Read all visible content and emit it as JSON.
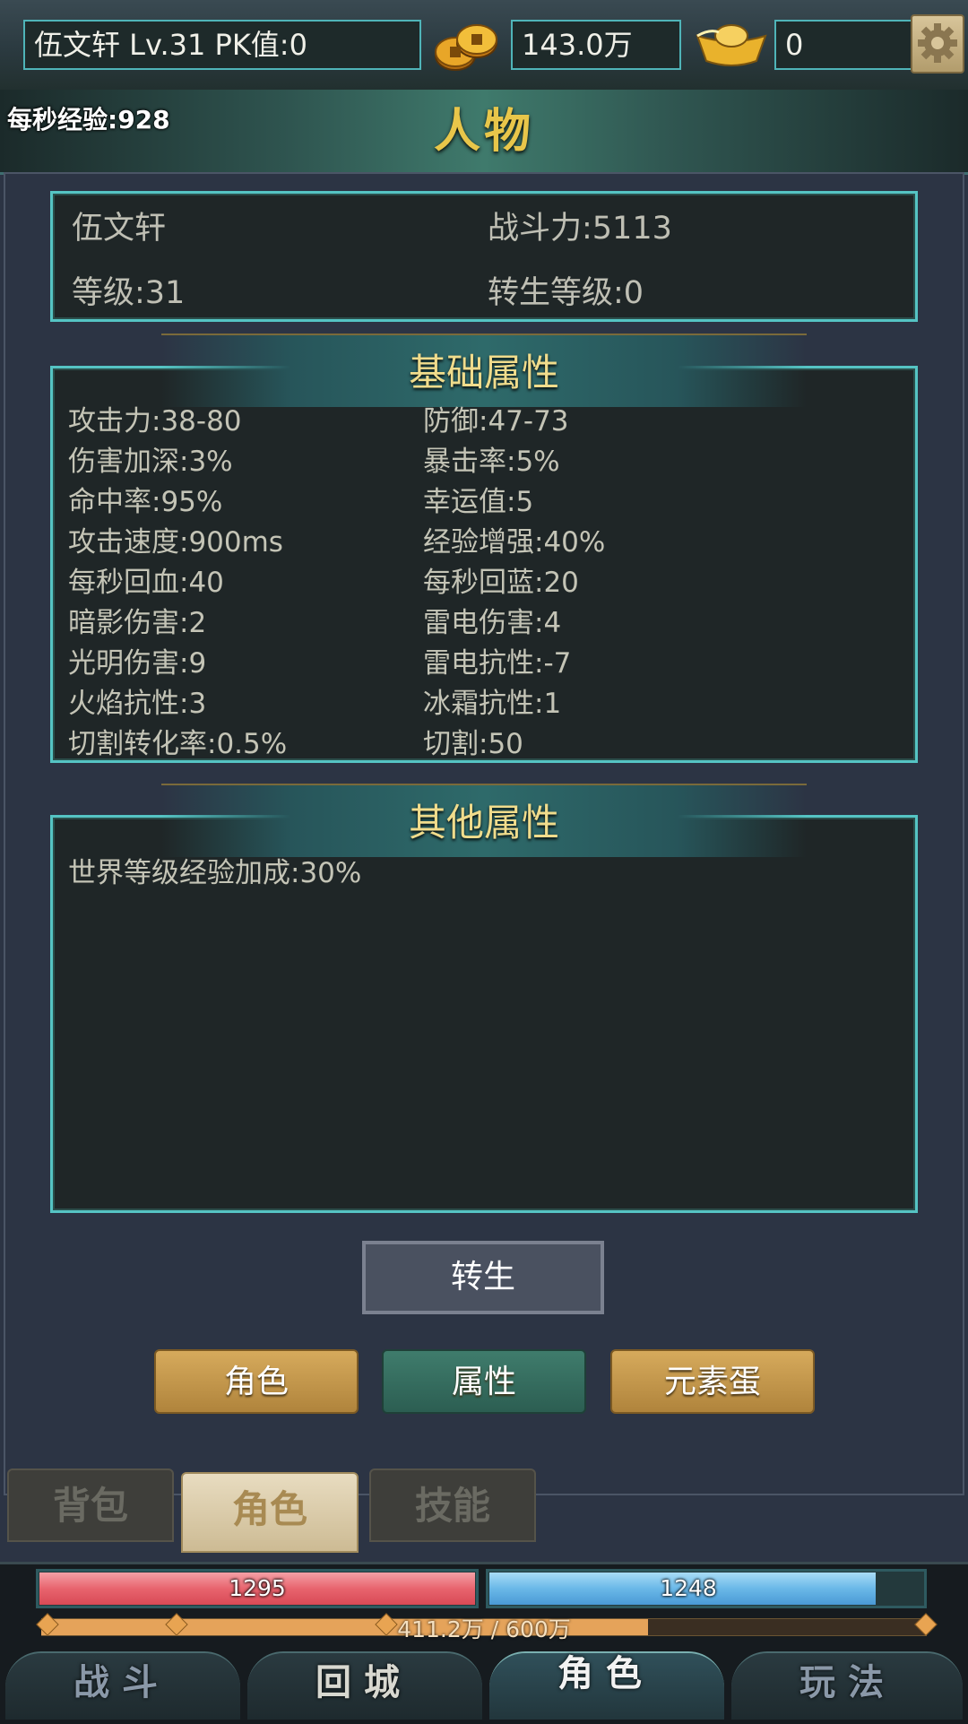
{
  "header": {
    "player_line": "伍文轩  Lv.31 PK值:0",
    "gold": "143.0万",
    "ingot": "0",
    "gold_icon": "gold-coins-icon",
    "ingot_icon": "gold-ingot-icon",
    "settings_icon": "gear-icon"
  },
  "banner": {
    "title": "人物",
    "exp_rate": "每秒经验:928"
  },
  "info": {
    "name": "伍文轩",
    "power": "战斗力:5113",
    "level": "等级:31",
    "rebirth_level": "转生等级:0"
  },
  "basic": {
    "title": "基础属性",
    "left": [
      "攻击力:38-80",
      "伤害加深:3%",
      "命中率:95%",
      "攻击速度:900ms",
      "每秒回血:40",
      "暗影伤害:2",
      "光明伤害:9",
      "火焰抗性:3",
      "切割转化率:0.5%"
    ],
    "right": [
      "防御:47-73",
      "暴击率:5%",
      "幸运值:5",
      "经验增强:40%",
      "每秒回蓝:20",
      "雷电伤害:4",
      "雷电抗性:-7",
      "冰霜抗性:1",
      "切割:50"
    ]
  },
  "other": {
    "title": "其他属性",
    "items": [
      "世界等级经验加成:30%"
    ]
  },
  "actions": {
    "rebirth": "转生"
  },
  "sub_tabs": [
    "角色",
    "属性",
    "元素蛋"
  ],
  "panel_tabs": [
    "背包",
    "角色",
    "技能"
  ],
  "hud": {
    "hp": "1295",
    "hp_fraction": 1.0,
    "mp": "1248",
    "mp_fraction": 0.89,
    "exp": "411.2万 / 600万",
    "exp_fraction": 0.685
  },
  "nav": [
    "战斗",
    "回城",
    "角色",
    "玩法"
  ],
  "colors": {
    "accent_teal": "#55c4c4",
    "title_gold": "#e8c64a",
    "hp_red": "#e8646e",
    "mp_blue": "#6ab8e8",
    "exp_orange": "#e5a35a"
  }
}
